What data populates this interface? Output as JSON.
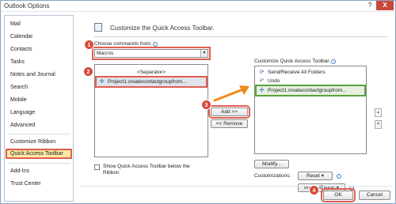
{
  "window": {
    "title": "Outlook Options",
    "help_glyph": "?",
    "close_glyph": "X"
  },
  "sidebar": {
    "items": [
      {
        "label": "Mail"
      },
      {
        "label": "Calendar"
      },
      {
        "label": "Contacts"
      },
      {
        "label": "Tasks"
      },
      {
        "label": "Notes and Journal"
      },
      {
        "label": "Search"
      },
      {
        "label": "Mobile"
      },
      {
        "label": "Language"
      },
      {
        "label": "Advanced"
      },
      {
        "label": "Customize Ribbon"
      },
      {
        "label": "Quick Access Toolbar"
      },
      {
        "label": "Add-Ins"
      },
      {
        "label": "Trust Center"
      }
    ],
    "active_index": 10
  },
  "main": {
    "header": "Customize the Quick Access Toolbar.",
    "choose_commands_label": "Choose commands from:",
    "choose_commands_value": "Macros",
    "left_list": [
      {
        "label": "<Separator>"
      },
      {
        "label": "Project1.createcontactgroupfrom..."
      }
    ],
    "add_button": "Add >>",
    "remove_button": "<< Remove",
    "show_below_label_line1": "Show Quick Access Toolbar below the",
    "show_below_label_line2": "Ribbon",
    "customize_qat_label": "Customize Quick Access Toolbar:",
    "right_list": [
      {
        "label": "Send/Receive All Folders",
        "icon": "send-receive-icon"
      },
      {
        "label": "Undo",
        "icon": "undo-icon"
      },
      {
        "label": "Project1.createcontactgroupfrom...",
        "icon": "macro-icon"
      }
    ],
    "modify_button": "Modify...",
    "customizations_label": "Customizations:",
    "reset_button": "Reset ▾",
    "import_export_button": "Import/Export ▾",
    "move_up_glyph": "▲",
    "move_down_glyph": "▼"
  },
  "footer": {
    "ok_button": "OK",
    "cancel_button": "Cancel"
  },
  "annotations": {
    "step1": "1",
    "step2": "2",
    "step3": "3",
    "step4": "4"
  },
  "colors": {
    "highlight_red": "#e05d50",
    "highlight_green": "#5aa33a",
    "arrow_orange": "#f08a1a",
    "selected_sidebar": "#fde7a3"
  }
}
